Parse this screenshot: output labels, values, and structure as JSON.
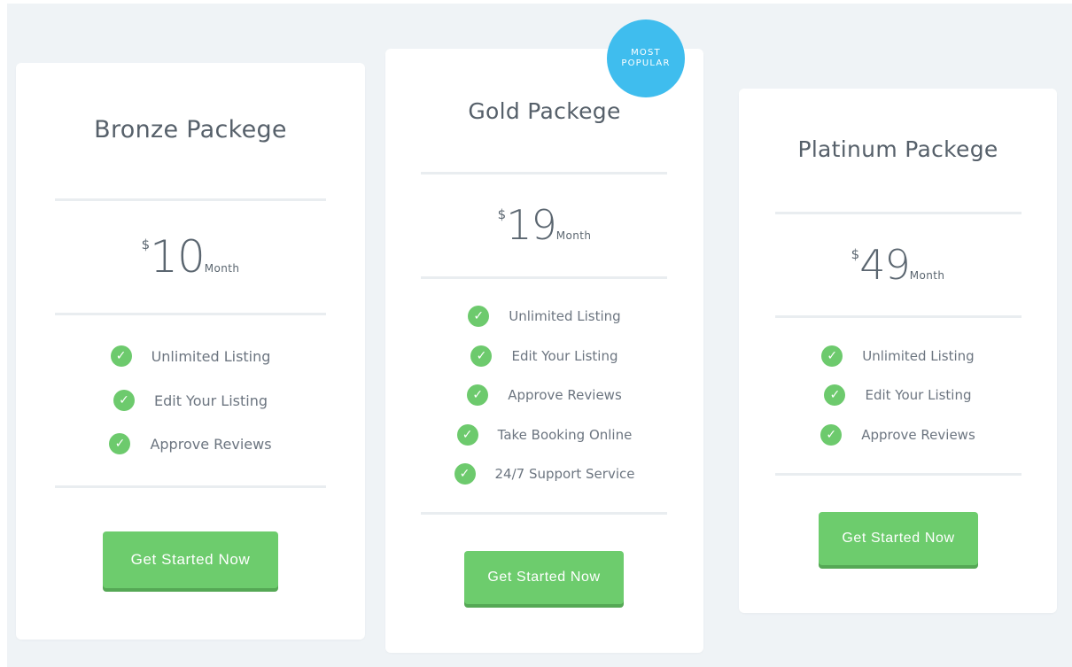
{
  "colors": {
    "background": "#eff3f6",
    "accent_green": "#6dcc6d",
    "badge_blue": "#3fbdee",
    "text": "#56606a"
  },
  "plans": [
    {
      "title": "Bronze Packege",
      "currency": "$",
      "price": "10",
      "period": "Month",
      "features": [
        "Unlimited Listing",
        "Edit Your Listing",
        "Approve Reviews"
      ],
      "button_label": "Get Started Now"
    },
    {
      "title": "Gold Packege",
      "currency": "$",
      "price": "19",
      "period": "Month",
      "badge_line1": "MOST",
      "badge_line2": "POPULAR",
      "features": [
        "Unlimited Listing",
        "Edit Your Listing",
        "Approve Reviews",
        "Take Booking Online",
        "24/7 Support Service"
      ],
      "button_label": "Get Started Now"
    },
    {
      "title": "Platinum Packege",
      "currency": "$",
      "price": "49",
      "period": "Month",
      "features": [
        "Unlimited Listing",
        "Edit Your Listing",
        "Approve Reviews"
      ],
      "button_label": "Get Started Now"
    }
  ],
  "icons": {
    "feature_check": "check-icon",
    "check_glyph": "✓"
  }
}
